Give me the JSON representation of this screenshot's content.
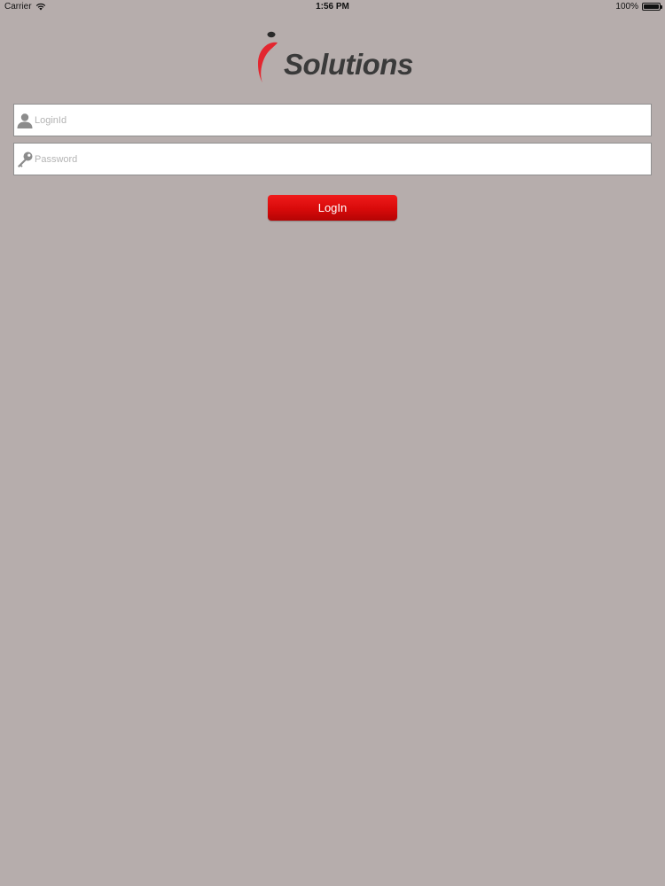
{
  "status_bar": {
    "carrier": "Carrier",
    "time": "1:56 PM",
    "battery": "100%",
    "battery_level": 1.0,
    "icons": {
      "wifi": "wifi-icon",
      "battery": "battery-icon"
    }
  },
  "logo": {
    "text": "Solutions",
    "accent_color": "#e3262f",
    "text_color": "#3a3a3a"
  },
  "login_form": {
    "login_id": {
      "placeholder": "LoginId",
      "value": "",
      "icon": "user-icon"
    },
    "password": {
      "placeholder": "Password",
      "value": "",
      "icon": "key-icon"
    },
    "submit_label": "LogIn",
    "button_color": "#d80a0a"
  },
  "colors": {
    "background": "#b6adac"
  }
}
